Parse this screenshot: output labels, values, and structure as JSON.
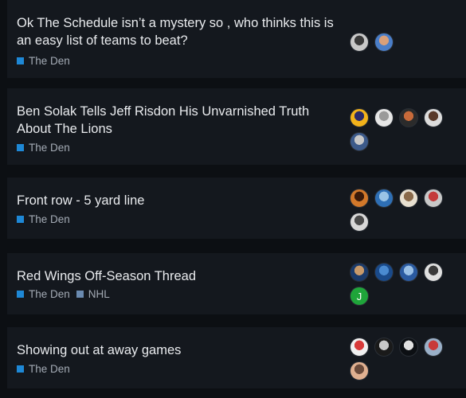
{
  "topics": [
    {
      "title": "Ok The Schedule isn’t a mystery so , who thinks this is an easy list of teams to beat?",
      "tags": [
        {
          "label": "The Den",
          "color": "#1e88d6"
        }
      ],
      "posters": [
        {
          "name": "poster-avatar",
          "colors": [
            "#c9c9c9",
            "#3a3a3a"
          ]
        },
        {
          "name": "poster-avatar",
          "colors": [
            "#4a7ec9",
            "#d9a07a"
          ]
        }
      ]
    },
    {
      "title": "Ben Solak Tells Jeff Risdon His Unvarnished Truth About The Lions",
      "tags": [
        {
          "label": "The Den",
          "color": "#1e88d6"
        }
      ],
      "posters": [
        {
          "name": "poster-avatar",
          "colors": [
            "#f2b21a",
            "#2a2a6a"
          ]
        },
        {
          "name": "poster-avatar",
          "colors": [
            "#e6e6e6",
            "#9a9a9a"
          ]
        },
        {
          "name": "poster-avatar",
          "colors": [
            "#2b2b2b",
            "#c86a3a"
          ]
        },
        {
          "name": "poster-avatar",
          "colors": [
            "#dcdcdc",
            "#5a3a2a"
          ]
        },
        {
          "name": "poster-avatar",
          "colors": [
            "#3c5a8a",
            "#c8c8c8"
          ]
        }
      ]
    },
    {
      "title": "Front row - 5 yard line",
      "tags": [
        {
          "label": "The Den",
          "color": "#1e88d6"
        }
      ],
      "posters": [
        {
          "name": "poster-avatar",
          "colors": [
            "#d2782a",
            "#3a1a0a"
          ]
        },
        {
          "name": "poster-avatar",
          "colors": [
            "#2e6fb5",
            "#9ac4e6"
          ]
        },
        {
          "name": "poster-avatar",
          "colors": [
            "#e8e0d0",
            "#8a6a4a"
          ]
        },
        {
          "name": "poster-avatar",
          "colors": [
            "#c8c8c8",
            "#c43a3a"
          ]
        },
        {
          "name": "poster-avatar",
          "colors": [
            "#d8d8d8",
            "#4a4a4a"
          ]
        }
      ]
    },
    {
      "title": "Red Wings Off-Season Thread",
      "tags": [
        {
          "label": "The Den",
          "color": "#1e88d6"
        },
        {
          "label": "NHL",
          "color": "#6a8ab0"
        }
      ],
      "posters": [
        {
          "name": "poster-avatar",
          "colors": [
            "#1a3a6a",
            "#c89a6a"
          ]
        },
        {
          "name": "poster-avatar",
          "colors": [
            "#1a4a8a",
            "#4a8ad0"
          ]
        },
        {
          "name": "poster-avatar",
          "colors": [
            "#2a5aa0",
            "#9ac0e6"
          ]
        },
        {
          "name": "poster-avatar",
          "colors": [
            "#e0e0e0",
            "#3a3a3a"
          ]
        },
        {
          "name": "poster-avatar",
          "colors": [
            "#1fa53a",
            "#1fa53a"
          ],
          "letter": "J"
        }
      ]
    },
    {
      "title": "Showing out at away games",
      "tags": [
        {
          "label": "The Den",
          "color": "#1e88d6"
        }
      ],
      "posters": [
        {
          "name": "poster-avatar",
          "colors": [
            "#f0f0f0",
            "#d83a3a"
          ]
        },
        {
          "name": "poster-avatar",
          "colors": [
            "#1a1a1a",
            "#c8c8c8"
          ]
        },
        {
          "name": "poster-avatar",
          "colors": [
            "#0c0f13",
            "#e0e0e0"
          ]
        },
        {
          "name": "poster-avatar",
          "colors": [
            "#9ab0c8",
            "#c83a3a"
          ]
        },
        {
          "name": "poster-avatar",
          "colors": [
            "#e0b090",
            "#6a4a3a"
          ]
        }
      ]
    }
  ]
}
